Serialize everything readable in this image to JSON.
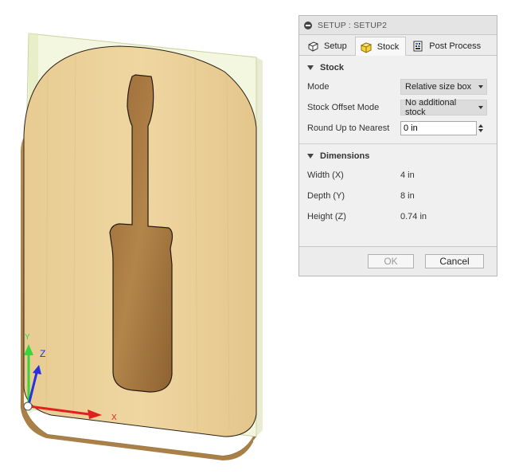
{
  "viewport": {
    "axis_labels": {
      "y": "Y",
      "z": "Z",
      "x": "X"
    },
    "colors": {
      "wood": "#e3c489",
      "stock": "#e8edb8",
      "axis_x": "#e01f1f",
      "axis_y": "#3bd43b",
      "axis_z": "#2432e0"
    }
  },
  "dialog": {
    "title": "SETUP : SETUP2",
    "tabs": [
      {
        "label": "Setup",
        "icon": "setup-icon"
      },
      {
        "label": "Stock",
        "icon": "stock-box-icon",
        "active": true
      },
      {
        "label": "Post Process",
        "icon": "post-process-icon"
      }
    ],
    "stock": {
      "header": "Stock",
      "mode_label": "Mode",
      "mode_value": "Relative size box",
      "offset_mode_label": "Stock Offset Mode",
      "offset_mode_value": "No additional stock",
      "round_up_label": "Round Up to Nearest",
      "round_up_value": "0 in"
    },
    "dimensions": {
      "header": "Dimensions",
      "width_label": "Width (X)",
      "width_value": "4 in",
      "depth_label": "Depth (Y)",
      "depth_value": "8 in",
      "height_label": "Height (Z)",
      "height_value": "0.74 in"
    },
    "buttons": {
      "ok": "OK",
      "cancel": "Cancel"
    }
  }
}
